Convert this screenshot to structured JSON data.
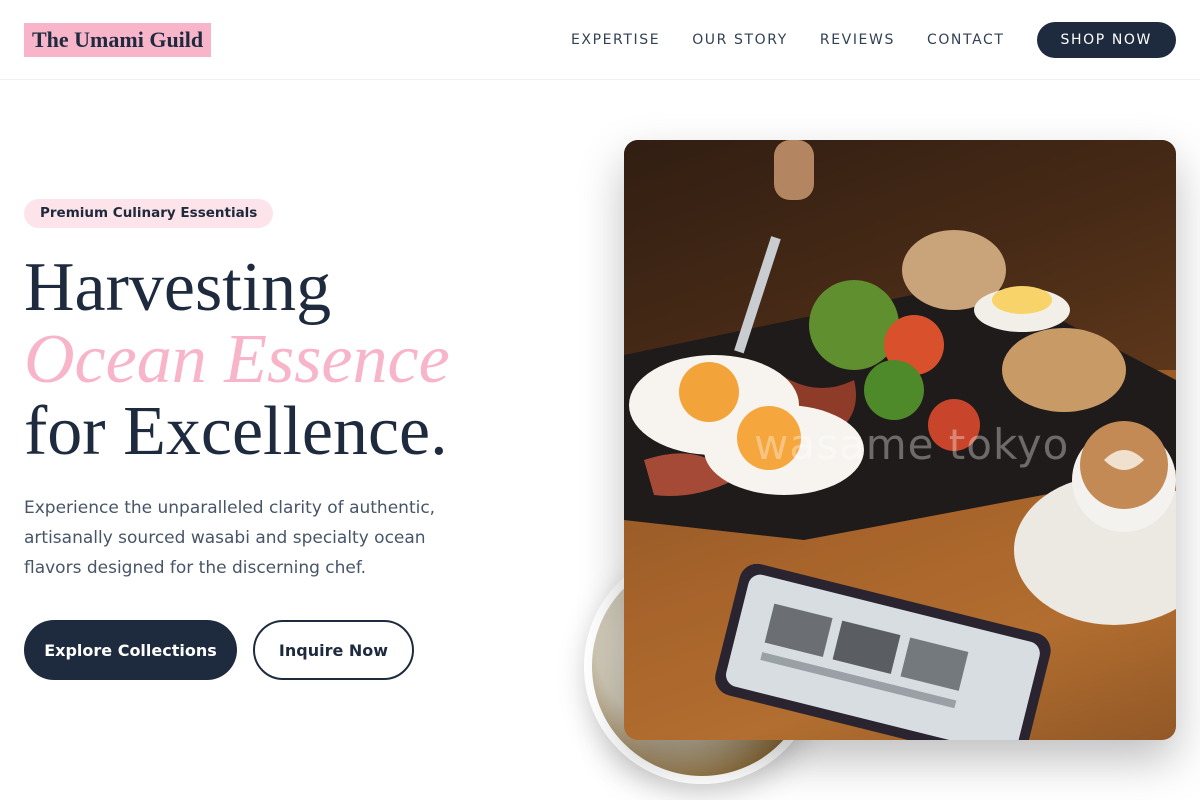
{
  "header": {
    "logo": "The Umami Guild",
    "nav": [
      "EXPERTISE",
      "OUR STORY",
      "REVIEWS",
      "CONTACT"
    ],
    "cta": "SHOP NOW"
  },
  "hero": {
    "badge": "Premium Culinary Essentials",
    "headline_line1": "Harvesting",
    "headline_line2": "Ocean Essence",
    "headline_line3": "for Excellence.",
    "description": "Experience the unparalleled clarity of authentic, artisanally sourced wasabi and specialty ocean flavors designed for the discerning chef.",
    "primary_button": "Explore Collections",
    "secondary_button": "Inquire Now",
    "image_watermark": "wasame tokyo"
  },
  "colors": {
    "navy": "#1e2a3e",
    "pink_accent": "#f8b4c8",
    "badge_bg": "#fde4ea"
  }
}
